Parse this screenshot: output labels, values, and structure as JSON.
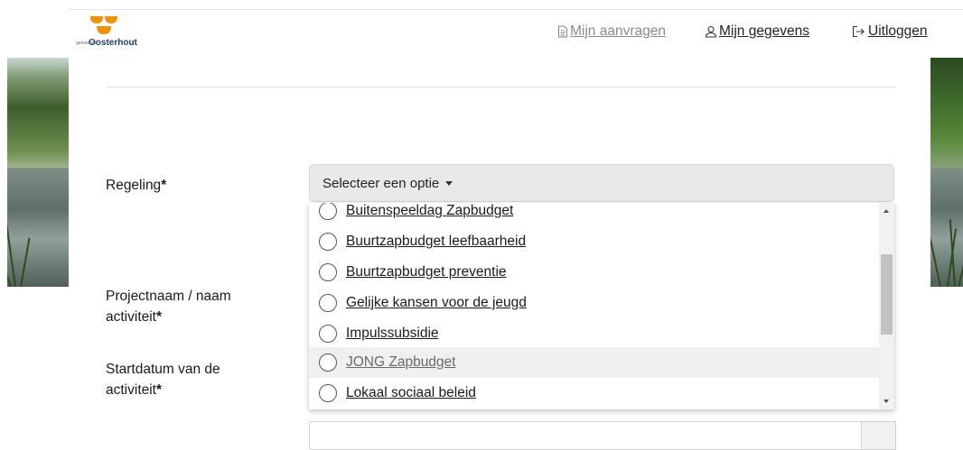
{
  "header": {
    "logo": {
      "small_text": "gemeente",
      "name": "Oosterhout",
      "brand_color": "#f39200"
    },
    "nav": {
      "requests": {
        "icon": "document-icon",
        "label": "Mijn aanvragen"
      },
      "profile": {
        "icon": "user-icon",
        "label": "Mijn gegevens"
      },
      "logout": {
        "icon": "logout-icon",
        "label": "Uitloggen"
      }
    }
  },
  "form": {
    "regeling": {
      "label": "Regeling",
      "required_mark": "*",
      "placeholder": "Selecteer een optie"
    },
    "project": {
      "label_line1": "Projectnaam / naam",
      "label_line2": "activiteit",
      "required_mark": "*"
    },
    "start": {
      "label_line1": "Startdatum van de",
      "label_line2": "activiteit",
      "required_mark": "*"
    }
  },
  "dropdown": {
    "options": [
      {
        "label": "Buitenspeeldag Zapbudget"
      },
      {
        "label": "Buurtzapbudget leefbaarheid"
      },
      {
        "label": "Buurtzapbudget preventie"
      },
      {
        "label": "Gelijke kansen voor de jeugd"
      },
      {
        "label": "Impulssubsidie"
      },
      {
        "label": "JONG Zapbudget",
        "hovered": true
      },
      {
        "label": "Lokaal sociaal beleid"
      }
    ]
  }
}
